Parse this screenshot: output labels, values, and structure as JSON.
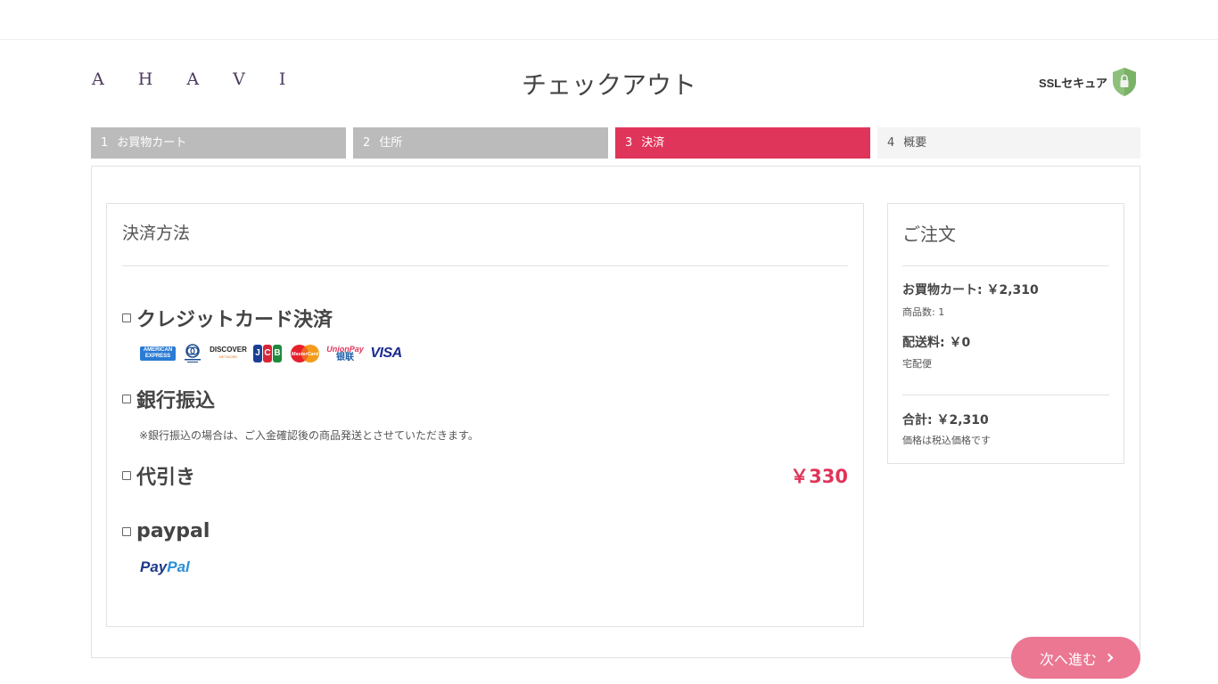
{
  "header": {
    "logo": "A H A V I",
    "title": "チェックアウト",
    "ssl_label": "SSLセキュア",
    "accent": "#e0355a"
  },
  "steps": [
    {
      "num": "1",
      "label": "お買物カート",
      "state": "done"
    },
    {
      "num": "2",
      "label": "住所",
      "state": "done"
    },
    {
      "num": "3",
      "label": "決済",
      "state": "active"
    },
    {
      "num": "4",
      "label": "概要",
      "state": "todo"
    }
  ],
  "payment": {
    "title": "決済方法",
    "methods": [
      {
        "label": "クレジットカード決済",
        "cards": [
          "AMERICAN EXPRESS",
          "Diners Club",
          "DISCOVER",
          "JCB",
          "MasterCard",
          "UnionPay",
          "VISA"
        ]
      },
      {
        "label": "銀行振込",
        "note": "※銀行振込の場合は、ご入金確認後の商品発送とさせていただきます。"
      },
      {
        "label": "代引き",
        "fee": "￥330"
      },
      {
        "label": "paypal",
        "logo_pay": "Pay",
        "logo_pal": "Pal"
      }
    ]
  },
  "order": {
    "title": "ご注文",
    "cart_label": "お買物カート: ￥2,310",
    "item_count": "商品数: 1",
    "shipping_label": "配送料: ￥0",
    "shipping_method": "宅配便",
    "total_label": "合計: ￥2,310",
    "tax_note": "価格は税込価格です"
  },
  "actions": {
    "next_label": "次へ進む"
  }
}
